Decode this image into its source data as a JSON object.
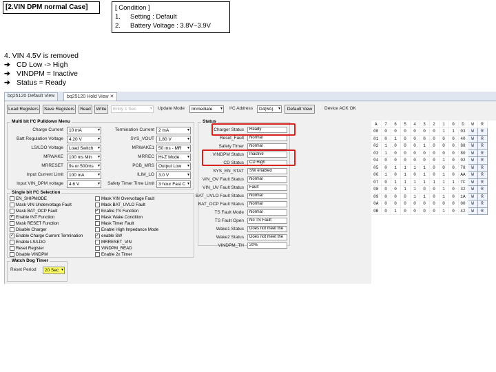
{
  "case_label": "[2.VIN DPM normal Case]",
  "condition": {
    "title": "[ Condition ]",
    "items": [
      {
        "num": "1.",
        "text": "Setting : Default"
      },
      {
        "num": "2.",
        "text": "Battery Voltage : 3.8V~3.9V"
      }
    ]
  },
  "notes": {
    "heading": "4. VIN 4.5V is removed",
    "arrow": "➔",
    "lines": [
      "CD Low -> High",
      "VINDPM = Inactive",
      "Status = Ready"
    ]
  },
  "tabs": [
    "bq25120 Default View",
    "bq25120 Hold View ✕"
  ],
  "toolbar": {
    "read_registers": "Load Registers",
    "save_registers": "Save Registers",
    "read": "Read",
    "write": "Write",
    "entry_value": "Entry 1 Sec",
    "update_mode_label": "Update Mode",
    "update_mode_value": "Immediate",
    "i2c_label": "I²C Address",
    "i2c_value": "D4(6A)",
    "default_view": "Default View",
    "device_status": "Device ACK OK"
  },
  "left": {
    "group_title": "Multi bit I²C Pulldown Menu",
    "rows": [
      {
        "label": "Charge Current",
        "value": "10 mA"
      },
      {
        "label": "Batt Regulation Voltage",
        "value": "4.20 V"
      },
      {
        "label": "LS/LDO Voltage",
        "value": "Load Switch"
      },
      {
        "label": "MRWAKE",
        "value": "100 ms Min"
      },
      {
        "label": "MRRESET",
        "value": "9s or 500ms"
      },
      {
        "label": "Input Current Limit",
        "value": "100 mA"
      },
      {
        "label": "Input VIN_DPM voltage",
        "value": "4.6 V"
      }
    ],
    "rows2": [
      {
        "label": "Termination Current",
        "value": "2 mA"
      },
      {
        "label": "SYS_VOUT",
        "value": "1.80 V"
      },
      {
        "label": "MRWAKE1",
        "value": "50 ms - MR"
      },
      {
        "label": "MRREC",
        "value": "Hi-Z Mode"
      },
      {
        "label": "PGB_MRS",
        "value": "Output Low"
      },
      {
        "label": "ILIM_LO",
        "value": "3.0 V"
      },
      {
        "label": "Safety Timer Time Limit",
        "value": "3 hour Fast C"
      }
    ]
  },
  "single": {
    "group_title": "Single bit I²C Selection",
    "col1": [
      {
        "label": "EN_SHIPMODE",
        "checked": false
      },
      {
        "label": "Mask VIN Undervoltage Fault",
        "checked": false
      },
      {
        "label": "Mask BAT_OCP Fault",
        "checked": false
      },
      {
        "label": "Enable INT Function",
        "checked": true
      },
      {
        "label": "Mask RESET Function",
        "checked": false
      },
      {
        "label": "Disable Charger",
        "checked": false
      },
      {
        "label": "Enable Charge Current Termination",
        "checked": true
      },
      {
        "label": "Enable LS/LDO",
        "checked": false
      },
      {
        "label": "Reset Register",
        "checked": false
      },
      {
        "label": "Disable VINDPM",
        "checked": false
      }
    ],
    "col2": [
      {
        "label": "Mask VIN Overvoltage Fault",
        "checked": false
      },
      {
        "label": "Mask BAT_UVLO Fault",
        "checked": false
      },
      {
        "label": "Enable TS Function",
        "checked": true
      },
      {
        "label": "Mask Wake Condition",
        "checked": false
      },
      {
        "label": "Mask Timer Fault",
        "checked": false
      },
      {
        "label": "Enable High Impedance Mode",
        "checked": false
      },
      {
        "label": "enable SW",
        "checked": true
      },
      {
        "label": "MRRESET_VIN",
        "checked": false
      },
      {
        "label": "VINDPM_READ",
        "checked": false
      },
      {
        "label": "Enable 2x Timer",
        "checked": false
      }
    ]
  },
  "watchdog": {
    "title": "Watch Dog Timer",
    "label": "Reset Period",
    "value": "20 Sec"
  },
  "status": {
    "group_title": "Status",
    "rows": [
      {
        "label": "Charger Status",
        "value": "Ready"
      },
      {
        "label": "Reset_Fault",
        "value": "Normal"
      },
      {
        "label": "Safety Timer",
        "value": "Normal"
      },
      {
        "label": "VINDPM Status",
        "value": "Inactive"
      },
      {
        "label": "CD Status",
        "value": "CD High"
      },
      {
        "label": "SYS_EN_STAT",
        "value": "SW enabled"
      },
      {
        "label": "VIN_OV Fault Status",
        "value": "Normal"
      },
      {
        "label": "VIN_UV Fault Status",
        "value": "Fault"
      },
      {
        "label": "BAT_UVLO Fault Status",
        "value": "Normal"
      },
      {
        "label": "BAT_OCP Fault Status",
        "value": "Normal"
      },
      {
        "label": "TS Fault Mode",
        "value": "Normal"
      },
      {
        "label": "TS Fault Open",
        "value": "No TS Fault"
      },
      {
        "label": "Wake1 Status",
        "value": "Does not meet the"
      },
      {
        "label": "Wake2 Status",
        "value": "Does not meet the"
      },
      {
        "label": "VINDPM_TH",
        "value": "20%"
      }
    ]
  },
  "regmap": {
    "headers": [
      "A",
      "7",
      "6",
      "5",
      "4",
      "3",
      "2",
      "1",
      "0",
      "D",
      "W",
      "R"
    ],
    "rows": [
      [
        "00",
        "0",
        "0",
        "0",
        "0",
        "0",
        "0",
        "1",
        "1",
        "03",
        "W",
        "R"
      ],
      [
        "01",
        "0",
        "1",
        "0",
        "0",
        "0",
        "0",
        "0",
        "0",
        "40",
        "W",
        "R"
      ],
      [
        "02",
        "1",
        "0",
        "0",
        "0",
        "1",
        "0",
        "0",
        "0",
        "88",
        "W",
        "R"
      ],
      [
        "03",
        "1",
        "0",
        "0",
        "0",
        "0",
        "0",
        "0",
        "0",
        "80",
        "W",
        "R"
      ],
      [
        "04",
        "0",
        "0",
        "0",
        "0",
        "0",
        "0",
        "1",
        "0",
        "02",
        "W",
        "R"
      ],
      [
        "05",
        "0",
        "1",
        "1",
        "1",
        "1",
        "0",
        "0",
        "0",
        "78",
        "W",
        "R"
      ],
      [
        "06",
        "1",
        "0",
        "1",
        "0",
        "1",
        "0",
        "1",
        "0",
        "AA",
        "W",
        "R"
      ],
      [
        "07",
        "0",
        "1",
        "1",
        "1",
        "1",
        "1",
        "1",
        "1",
        "7F",
        "W",
        "R"
      ],
      [
        "08",
        "0",
        "0",
        "1",
        "1",
        "0",
        "0",
        "1",
        "0",
        "32",
        "W",
        "R"
      ],
      [
        "09",
        "0",
        "0",
        "0",
        "1",
        "1",
        "0",
        "1",
        "0",
        "1A",
        "W",
        "R"
      ],
      [
        "0A",
        "0",
        "0",
        "0",
        "0",
        "0",
        "0",
        "0",
        "0",
        "00",
        "W",
        "R"
      ],
      [
        "0B",
        "0",
        "1",
        "0",
        "0",
        "0",
        "0",
        "1",
        "0",
        "42",
        "W",
        "R"
      ]
    ]
  },
  "colors": {
    "highlight": "#d9221f",
    "watchdog_value_bg": "#ffff66"
  }
}
